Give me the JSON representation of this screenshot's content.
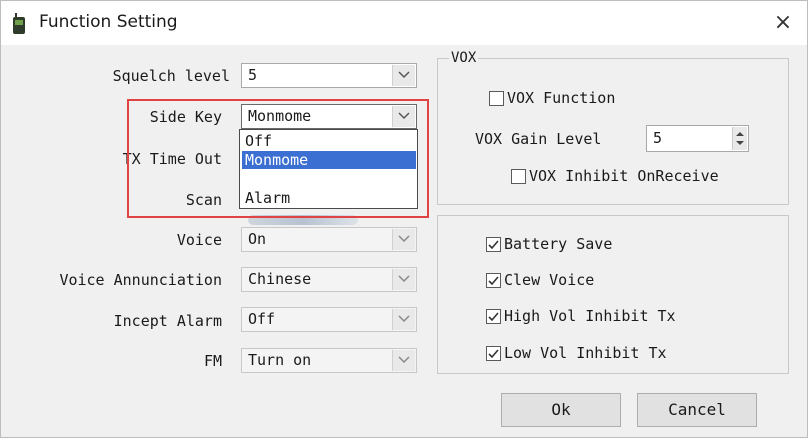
{
  "window": {
    "title": "Function Setting",
    "close_glyph": "×"
  },
  "left": {
    "squelch": {
      "label": "Squelch level",
      "value": "5"
    },
    "side_key": {
      "label": "Side Key",
      "value": "Monmome",
      "options": [
        "Off",
        "Monmome",
        "",
        "Alarm"
      ]
    },
    "tx_timeout": {
      "label": "TX Time Out"
    },
    "scan": {
      "label": "Scan"
    },
    "voice": {
      "label": "Voice",
      "value": "On"
    },
    "voice_annunciation": {
      "label": "Voice Annunciation",
      "value": "Chinese"
    },
    "incept_alarm": {
      "label": "Incept Alarm",
      "value": "Off"
    },
    "fm": {
      "label": "FM",
      "value": "Turn on"
    }
  },
  "vox": {
    "title": "VOX",
    "function": {
      "label": "VOX Function",
      "checked": false
    },
    "gain": {
      "label": "VOX Gain Level",
      "value": "5"
    },
    "inhibit": {
      "label": "VOX Inhibit OnReceive",
      "checked": false
    }
  },
  "options": {
    "battery_save": {
      "label": "Battery Save",
      "checked": true
    },
    "clew_voice": {
      "label": "Clew Voice",
      "checked": true
    },
    "high_vol": {
      "label": "High Vol Inhibit Tx",
      "checked": true
    },
    "low_vol": {
      "label": "Low Vol Inhibit Tx",
      "checked": true
    }
  },
  "buttons": {
    "ok": "Ok",
    "cancel": "Cancel"
  },
  "colors": {
    "highlight": "#e04343",
    "selection": "#3b6fd1"
  },
  "icons": [
    "radio-app-icon",
    "close-icon",
    "dropdown-arrow-icon",
    "checkmark-icon",
    "spin-arrows-icon"
  ]
}
